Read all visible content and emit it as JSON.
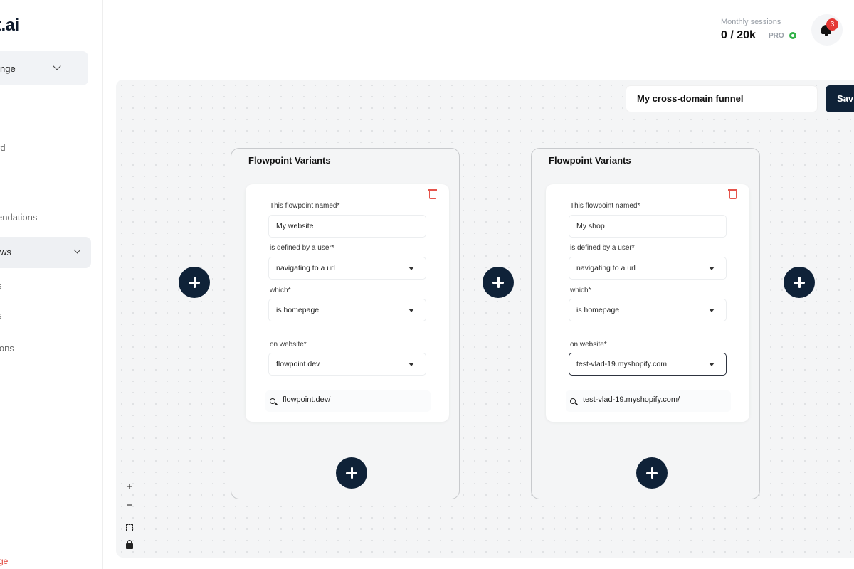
{
  "sidebar": {
    "logo": "t.ai",
    "workspace": "nge",
    "items": [
      {
        "label": "rd"
      },
      {
        "label": "endations"
      },
      {
        "label": "ws"
      },
      {
        "label": "s"
      },
      {
        "label": "s"
      },
      {
        "label": "ions"
      }
    ],
    "bottom_red": "ge"
  },
  "header": {
    "sessions_label": "Monthly sessions",
    "sessions_value": "0 / 20k",
    "plan": "PRO",
    "notifications_count": "3"
  },
  "toolbar": {
    "funnel_name": "My cross-domain funnel",
    "save_label": "Sav"
  },
  "panels": [
    {
      "title": "Flowpoint Variants",
      "name_label": "This flowpoint named*",
      "name_value": "My website",
      "defined_label": "is defined by a user*",
      "defined_value": "navigating to a url",
      "which_label": "which*",
      "which_value": "is homepage",
      "website_label": "on website*",
      "website_value": "flowpoint.dev",
      "url_value": "flowpoint.dev/"
    },
    {
      "title": "Flowpoint Variants",
      "name_label": "This flowpoint named*",
      "name_value": "My shop",
      "defined_label": "is defined by a user*",
      "defined_value": "navigating to a url",
      "which_label": "which*",
      "which_value": "is homepage",
      "website_label": "on website*",
      "website_value": "test-vlad-19.myshopify.com",
      "url_value": "test-vlad-19.myshopify.com/"
    }
  ],
  "zoom_controls": {
    "zoom_in": "+",
    "zoom_out": "−"
  },
  "colors": {
    "primary": "#0f2238",
    "danger": "#e5534b",
    "success": "#33b249",
    "canvas": "#f4f5f6"
  }
}
